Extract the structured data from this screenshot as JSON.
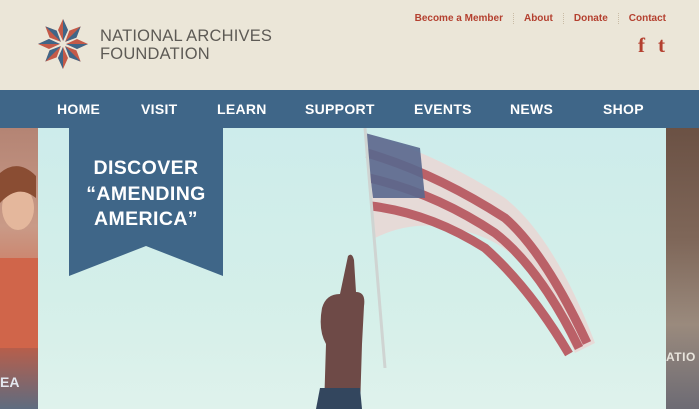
{
  "brand": {
    "line1": "NATIONAL ARCHIVES",
    "line2": "FOUNDATION",
    "logo_colors": [
      "#3f6688",
      "#c45a48",
      "#d6a385",
      "#8aa3b9"
    ]
  },
  "utility_nav": [
    {
      "label": "Become a Member"
    },
    {
      "label": "About"
    },
    {
      "label": "Donate"
    },
    {
      "label": "Contact"
    }
  ],
  "social": {
    "facebook": {
      "icon": "facebook-icon",
      "glyph": "f"
    },
    "twitter": {
      "icon": "twitter-icon",
      "glyph": "t"
    }
  },
  "main_nav": [
    {
      "label": "HOME"
    },
    {
      "label": "VISIT"
    },
    {
      "label": "LEARN"
    },
    {
      "label": "SUPPORT"
    },
    {
      "label": "EVENTS"
    },
    {
      "label": "NEWS"
    },
    {
      "label": "SHOP"
    }
  ],
  "hero": {
    "banner_line1": "DISCOVER",
    "banner_line2": "“AMENDING",
    "banner_line3": "AMERICA”",
    "right_edge_text": "ATIO",
    "left_edge_text": "EA"
  },
  "colors": {
    "nav_bg": "#3f6688",
    "accent": "#b4402f",
    "header_bg": "#ebe6d8",
    "banner_bg": "#3f6688"
  }
}
